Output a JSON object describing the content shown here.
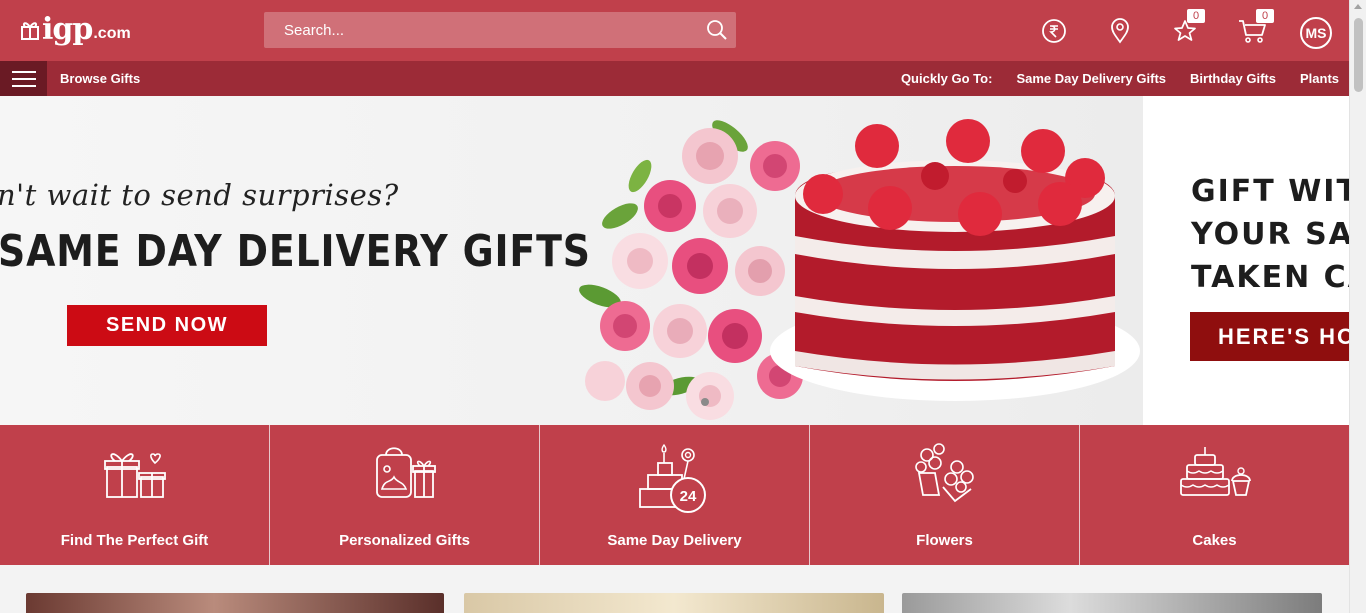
{
  "header": {
    "logo_mark": "igp",
    "logo_suffix": ".com",
    "search": {
      "placeholder": "Search..."
    },
    "wishlist_count": "0",
    "cart_count": "0",
    "user_initials": "MS"
  },
  "subnav": {
    "browse_label": "Browse Gifts",
    "quick_label": "Quickly Go To:",
    "quick_links": [
      "Same Day Delivery Gifts",
      "Birthday Gifts",
      "Plants"
    ]
  },
  "banner": {
    "tagline": "n't wait to send surprises?",
    "headline": "SAME DAY DELIVERY GIFTS",
    "cta": "SEND NOW",
    "right_lines": [
      "GIFT WIT",
      "YOUR SA",
      "TAKEN CA"
    ],
    "right_cta": "HERE'S HO"
  },
  "categories": [
    {
      "label": "Find The Perfect Gift",
      "icon": "gift-boxes-icon"
    },
    {
      "label": "Personalized Gifts",
      "icon": "personalized-bag-icon"
    },
    {
      "label": "Same Day Delivery",
      "icon": "24-hour-delivery-icon"
    },
    {
      "label": "Flowers",
      "icon": "flower-bouquet-icon"
    },
    {
      "label": "Cakes",
      "icon": "cake-icon"
    }
  ],
  "colors": {
    "brand": "#c0404b",
    "subnav": "#9c2b37",
    "cta_red": "#cc0b14"
  }
}
